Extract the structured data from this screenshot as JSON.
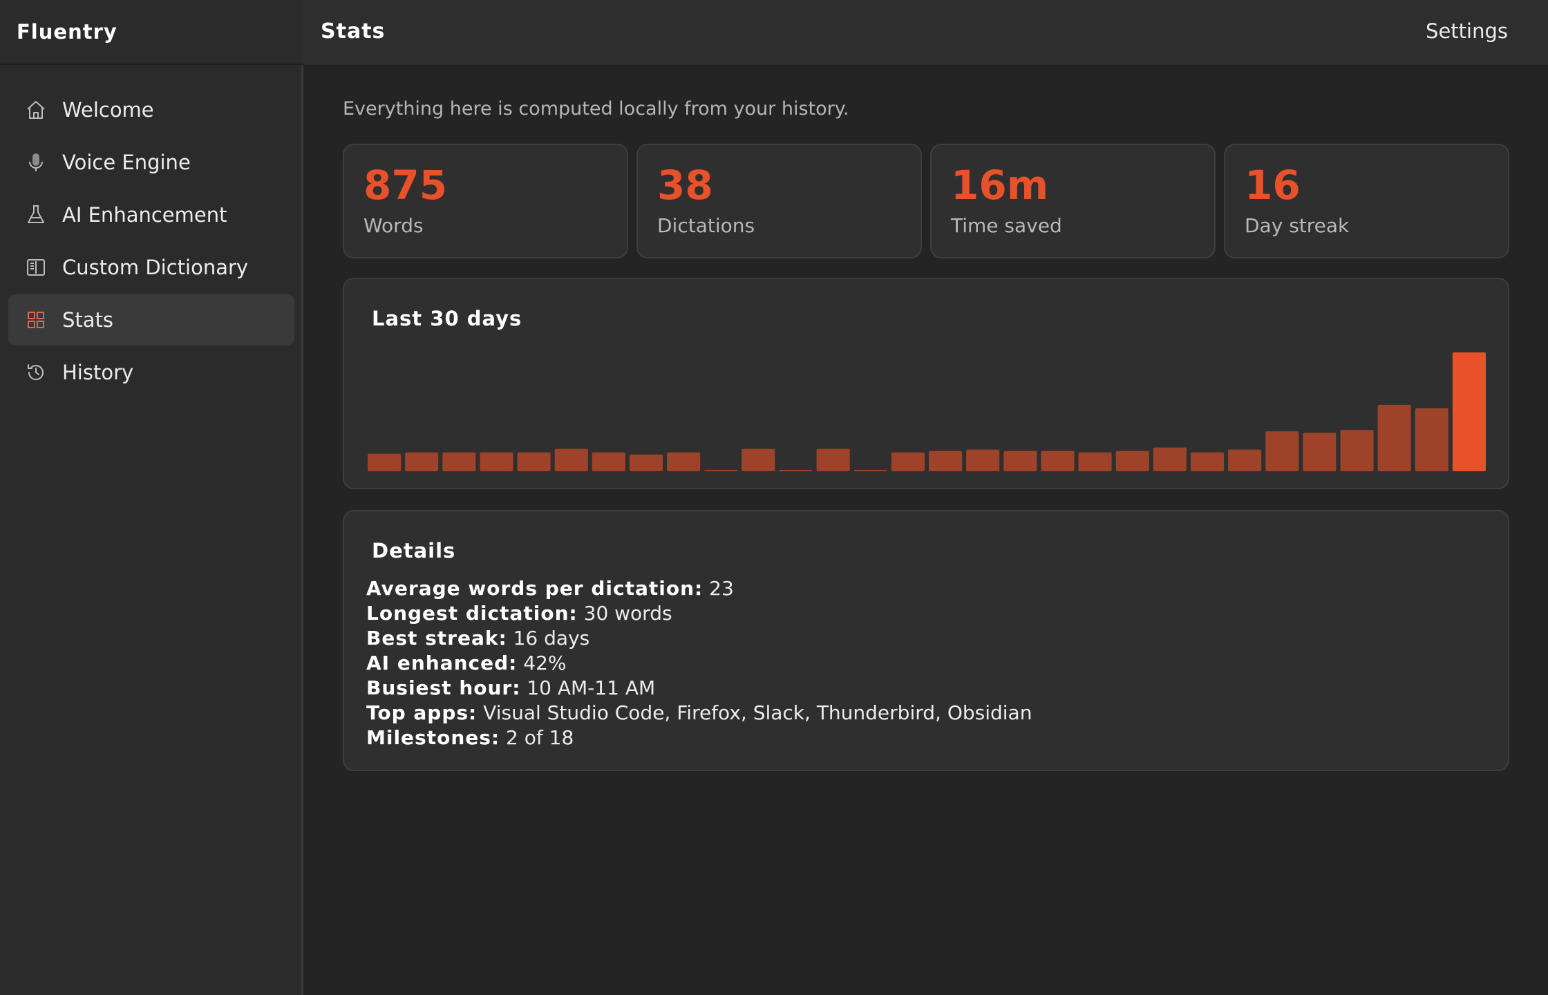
{
  "app": {
    "name": "Fluentry"
  },
  "header": {
    "title": "Stats",
    "settings_label": "Settings"
  },
  "sidebar": {
    "items": [
      {
        "label": "Welcome",
        "icon": "home-icon"
      },
      {
        "label": "Voice Engine",
        "icon": "microphone-icon"
      },
      {
        "label": "AI Enhancement",
        "icon": "flask-icon"
      },
      {
        "label": "Custom Dictionary",
        "icon": "book-icon"
      },
      {
        "label": "Stats",
        "icon": "grid-icon",
        "active": true
      },
      {
        "label": "History",
        "icon": "history-icon"
      }
    ]
  },
  "main": {
    "subtitle": "Everything here is computed locally from your history.",
    "stats": [
      {
        "value": "875",
        "label": "Words"
      },
      {
        "value": "38",
        "label": "Dictations"
      },
      {
        "value": "16m",
        "label": "Time saved"
      },
      {
        "value": "16",
        "label": "Day streak"
      }
    ],
    "chart_title": "Last 30 days",
    "details_title": "Details",
    "details": [
      {
        "key": "Average words per dictation:",
        "value": "23"
      },
      {
        "key": "Longest dictation:",
        "value": "30 words"
      },
      {
        "key": "Best streak:",
        "value": "16 days"
      },
      {
        "key": "AI enhanced:",
        "value": "42%"
      },
      {
        "key": "Busiest hour:",
        "value": "10 AM-11 AM"
      },
      {
        "key": "Top apps:",
        "value": "Visual Studio Code, Firefox, Slack, Thunderbird, Obsidian"
      },
      {
        "key": "Milestones:",
        "value": "2 of 18"
      }
    ]
  },
  "colors": {
    "accent": "#e8512a",
    "bar": "#9e4329",
    "bar_today": "#e8512a",
    "background": "#242424",
    "card": "#2f2f2f"
  },
  "chart_data": {
    "type": "bar",
    "title": "Last 30 days",
    "values": [
      25,
      27,
      27,
      27,
      27,
      32,
      27,
      24,
      27,
      1,
      32,
      1,
      32,
      1,
      27,
      29,
      31,
      29,
      29,
      27,
      29,
      34,
      27,
      31,
      57,
      55,
      59,
      95,
      90,
      170
    ],
    "ylim": [
      0,
      170
    ],
    "grid": false,
    "legend": "none"
  }
}
